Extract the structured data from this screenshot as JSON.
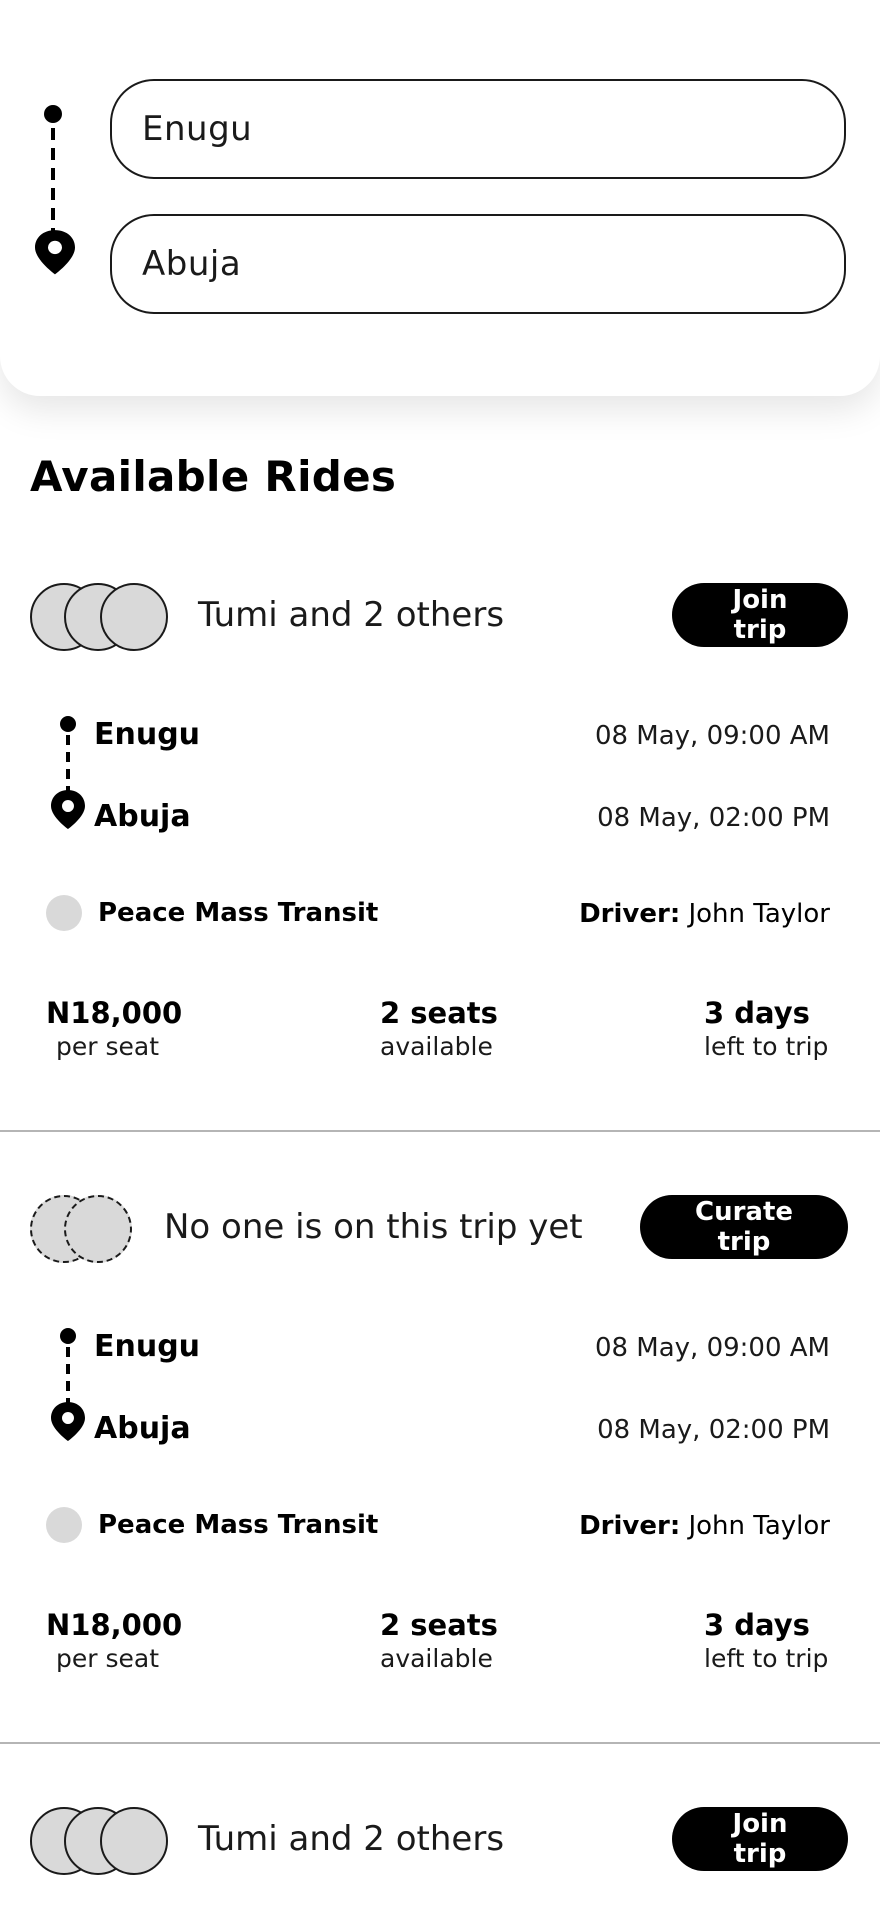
{
  "search": {
    "from_value": "Enugu",
    "to_value": "Abuja"
  },
  "section_title": "Available Rides",
  "rides": [
    {
      "riders_text": "Tumi and 2 others",
      "action_label": "Join trip",
      "from": "Enugu",
      "from_time": "08 May, 09:00 AM",
      "to": "Abuja",
      "to_time": "08 May, 02:00 PM",
      "operator": "Peace Mass Transit",
      "driver_label": "Driver:",
      "driver_name": "John Taylor",
      "price": "N18,000",
      "price_sub": "per seat",
      "seats": "2 seats",
      "seats_sub": "available",
      "days": "3 days",
      "days_sub": "left to trip"
    },
    {
      "riders_text": "No one is on this trip yet",
      "action_label": "Curate trip",
      "from": "Enugu",
      "from_time": "08 May, 09:00 AM",
      "to": "Abuja",
      "to_time": "08 May, 02:00 PM",
      "operator": "Peace Mass Transit",
      "driver_label": "Driver:",
      "driver_name": "John Taylor",
      "price": "N18,000",
      "price_sub": "per seat",
      "seats": "2 seats",
      "seats_sub": "available",
      "days": "3 days",
      "days_sub": "left to trip"
    },
    {
      "riders_text": "Tumi and 2 others",
      "action_label": "Join trip"
    }
  ],
  "colors": {
    "accent": "#000000",
    "avatar_fill": "#d9d9d9",
    "divider": "#b5b5b5"
  }
}
